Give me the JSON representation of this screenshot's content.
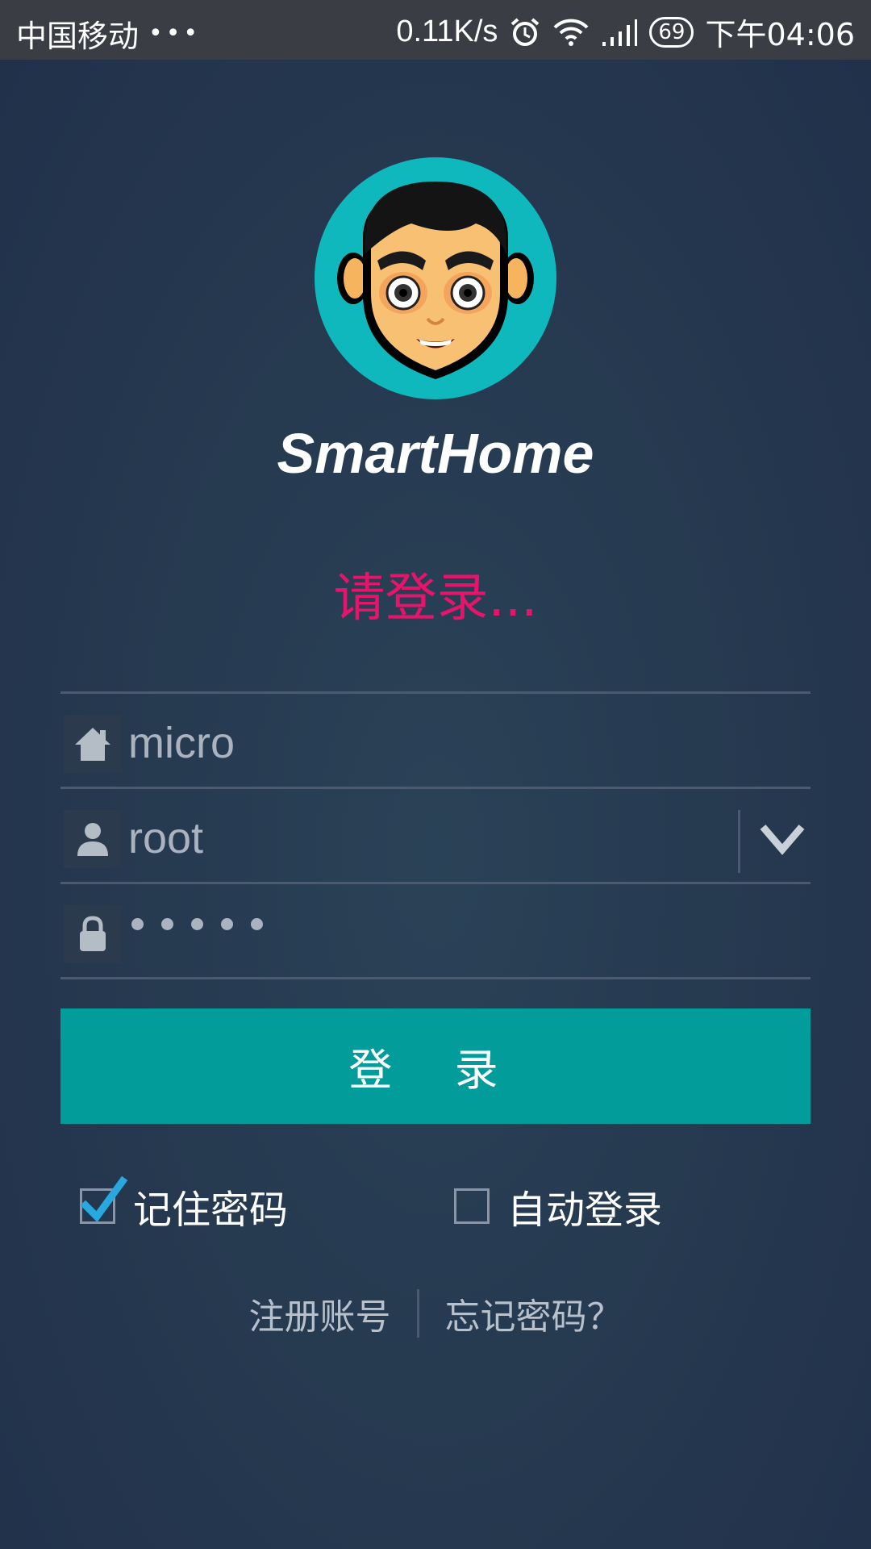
{
  "status_bar": {
    "carrier": "中国移动",
    "dots": "•••",
    "net_speed": "0.11K/s",
    "battery": "69",
    "time": "下午04:06",
    "icons": [
      "alarm-icon",
      "wifi-icon",
      "signal-icon",
      "battery-icon"
    ]
  },
  "app": {
    "title": "SmartHome",
    "prompt": "请登录...",
    "avatar": "avatar-face-icon"
  },
  "form": {
    "home_value": "micro",
    "user_value": "root",
    "password_mask_count": 5
  },
  "actions": {
    "login_label": "登 录"
  },
  "options": {
    "remember_label": "记住密码",
    "remember_checked": true,
    "auto_label": "自动登录",
    "auto_checked": false
  },
  "links": {
    "register": "注册账号",
    "forgot": "忘记密码？"
  },
  "colors": {
    "accent": "#029c9b",
    "prompt": "#e8136a",
    "avatar_bg": "#0fb8bc",
    "check": "#29a8e0"
  }
}
